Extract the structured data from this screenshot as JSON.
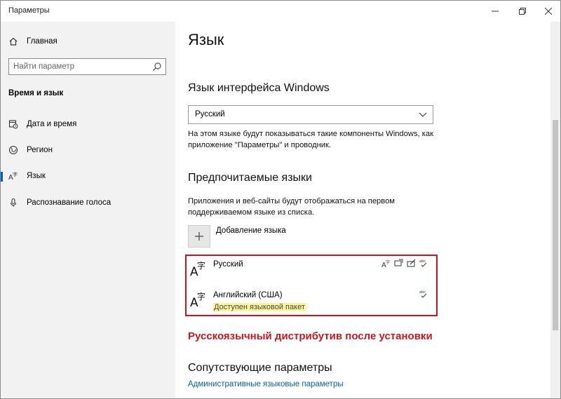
{
  "window": {
    "title": "Параметры",
    "controls": {
      "minimize": "minimize-icon",
      "maximize": "restore-icon",
      "close": "close-icon"
    }
  },
  "sidebar": {
    "home_label": "Главная",
    "search_placeholder": "Найти параметр",
    "section_title": "Время и язык",
    "items": [
      {
        "label": "Дата и время",
        "icon": "calendar-clock-icon"
      },
      {
        "label": "Регион",
        "icon": "globe-icon"
      },
      {
        "label": "Язык",
        "icon": "language-icon",
        "active": true
      },
      {
        "label": "Распознавание голоса",
        "icon": "microphone-icon"
      }
    ]
  },
  "main": {
    "page_title": "Язык",
    "display_language": {
      "heading": "Язык интерфейса Windows",
      "selected": "Русский",
      "description": "На этом языке будут показываться такие компоненты Windows, как приложение \"Параметры\" и проводник."
    },
    "preferred": {
      "heading": "Предпочитаемые языки",
      "description": "Приложения и веб-сайты будут отображаться на первом поддерживаемом языке из списка.",
      "add_label": "Добавление языка",
      "languages": [
        {
          "name": "Русский",
          "status": "",
          "features": [
            "display-language-icon",
            "speech-icon",
            "handwriting-icon",
            "spellcheck-icon"
          ]
        },
        {
          "name": "Английский (США)",
          "status": "Доступен языковой пакет",
          "features": [
            "spellcheck-icon"
          ]
        }
      ]
    },
    "annotation": "Русскоязычный дистрибутив после установки",
    "related": {
      "heading": "Сопутствующие параметры",
      "link": "Административные языковые параметры"
    }
  },
  "colors": {
    "accent": "#0063b1",
    "annotation": "#c8191e",
    "highlight": "#fff59d",
    "sidebar_bg": "#f2f2f2"
  }
}
